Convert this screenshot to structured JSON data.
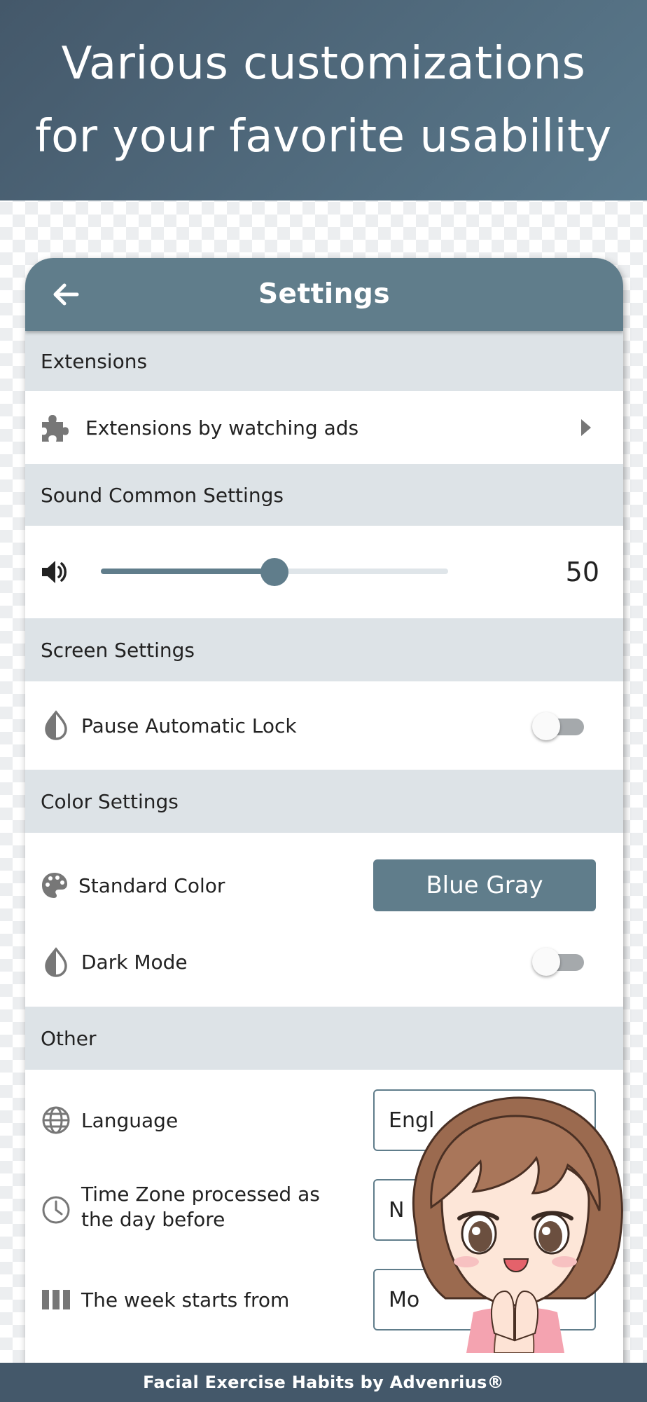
{
  "banner": {
    "line1": "Various customizations",
    "line2": "for your favorite usability"
  },
  "appbar": {
    "title": "Settings",
    "back_icon": "arrow-left-icon"
  },
  "sections": {
    "extensions": {
      "header": "Extensions",
      "item_label": "Extensions by watching ads",
      "item_icon": "puzzle-piece-icon",
      "chevron_icon": "caret-right-icon"
    },
    "sound": {
      "header": "Sound Common Settings",
      "volume_icon": "volume-icon",
      "volume_value": "50",
      "volume_fraction": 0.5
    },
    "screen": {
      "header": "Screen Settings",
      "pause_lock_label": "Pause Automatic Lock",
      "pause_lock_icon": "contrast-drop-icon",
      "pause_lock_on": false
    },
    "color": {
      "header": "Color Settings",
      "standard_color_label": "Standard Color",
      "standard_color_icon": "palette-icon",
      "standard_color_value": "Blue Gray",
      "dark_mode_label": "Dark Mode",
      "dark_mode_icon": "contrast-drop-icon",
      "dark_mode_on": false
    },
    "other": {
      "header": "Other",
      "language_label": "Language",
      "language_icon": "globe-icon",
      "language_value": "Engl",
      "timezone_label_1": "Time Zone processed as",
      "timezone_label_2": "the day before",
      "timezone_icon": "clock-icon",
      "timezone_value": "N",
      "week_start_label": "The week starts from",
      "week_start_icon": "columns-icon",
      "week_start_value": "Mo"
    }
  },
  "footer": {
    "text": "Facial Exercise Habits by Advenrius®"
  },
  "colors": {
    "primary": "#607d8b",
    "banner": "#44586a",
    "section_bg": "#dde3e7"
  }
}
